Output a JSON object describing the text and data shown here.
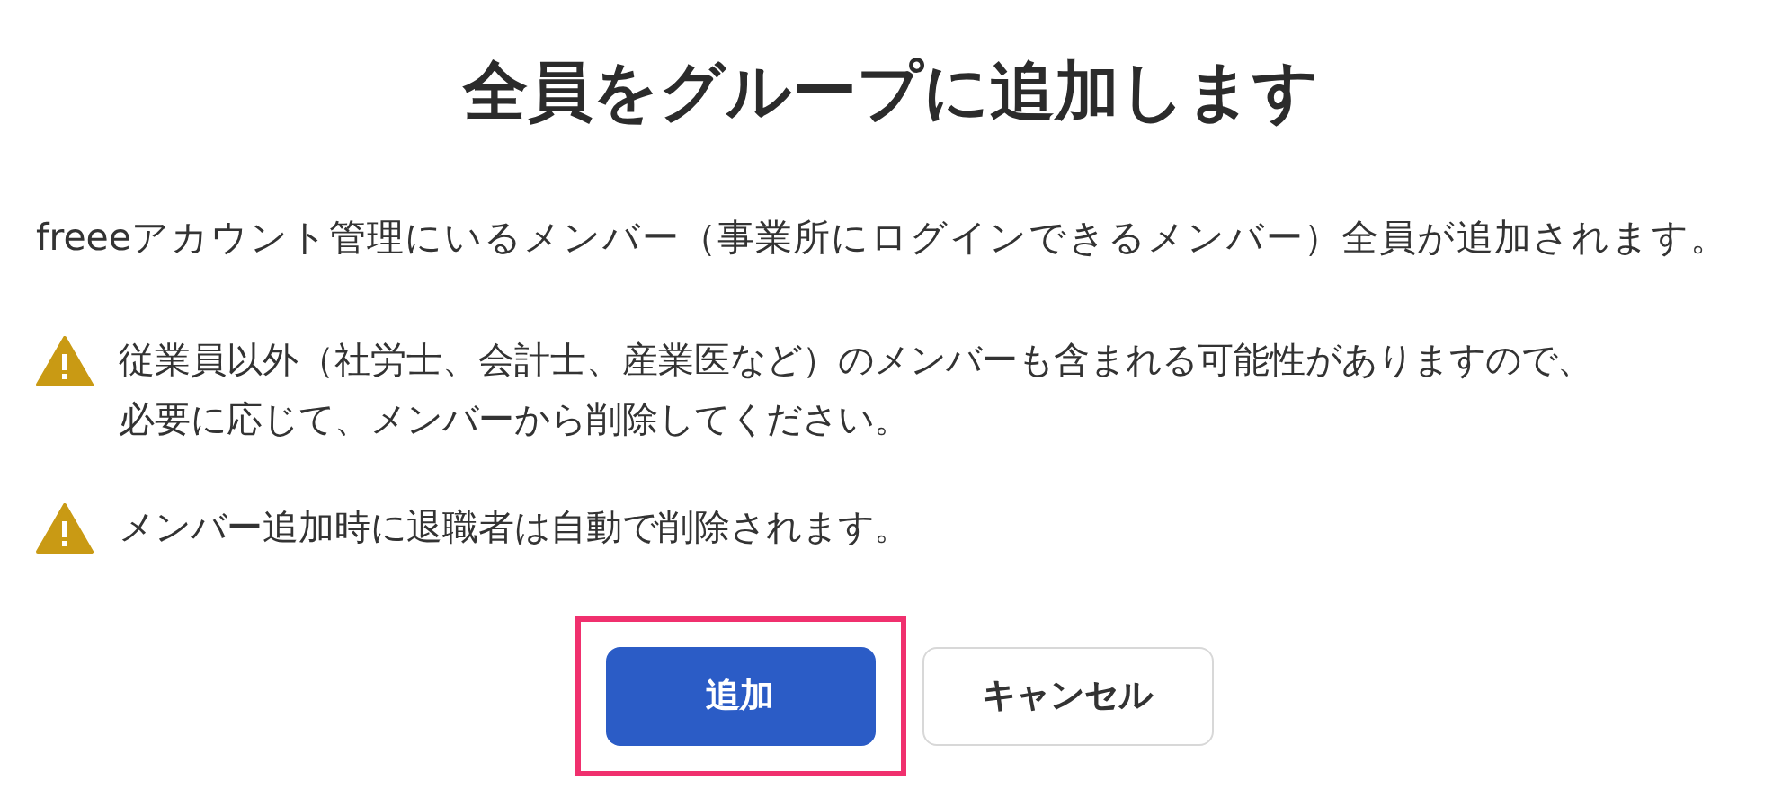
{
  "title": "全員をグループに追加します",
  "description": "freeeアカウント管理にいるメンバー（事業所にログインできるメンバー）全員が追加されます。",
  "warnings": [
    {
      "text": "従業員以外（社労士、会計士、産業医など）のメンバーも含まれる可能性がありますので、必要に応じて、メンバーから削除してください。"
    },
    {
      "text": "メンバー追加時に退職者は自動で削除されます。"
    }
  ],
  "buttons": [
    {
      "label": "追加",
      "kind": "primary",
      "highlighted": true
    },
    {
      "label": "キャンセル",
      "kind": "secondary",
      "highlighted": false
    }
  ]
}
